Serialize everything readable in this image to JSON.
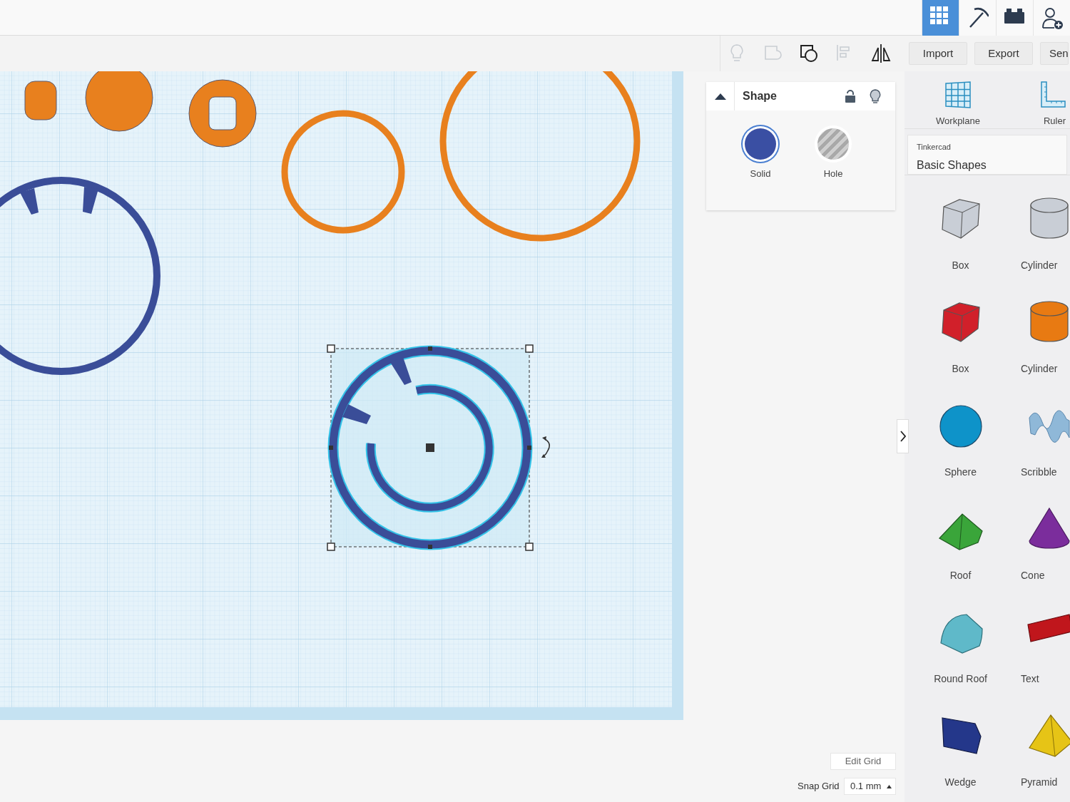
{
  "top_tabs": [
    {
      "kind": "grid",
      "selected": true
    },
    {
      "kind": "pickaxe",
      "selected": false
    },
    {
      "kind": "brick",
      "selected": false
    },
    {
      "kind": "user-add",
      "selected": false
    }
  ],
  "toolbar": {
    "tools": [
      {
        "kind": "bulb",
        "disabled": true
      },
      {
        "kind": "group",
        "disabled": true
      },
      {
        "kind": "ungroup",
        "disabled": false
      },
      {
        "kind": "align",
        "disabled": true
      },
      {
        "kind": "mirror",
        "disabled": false
      }
    ],
    "buttons": [
      "Import",
      "Export",
      "Sen"
    ]
  },
  "shape_panel": {
    "title": "Shape",
    "options": [
      {
        "label": "Solid",
        "kind": "solid",
        "selected": true
      },
      {
        "label": "Hole",
        "kind": "hole",
        "selected": false
      }
    ]
  },
  "grid_controls": {
    "edit_button": "Edit Grid",
    "snap_label": "Snap Grid",
    "snap_value": "0.1 mm"
  },
  "sidebar": {
    "tools": [
      {
        "label": "Workplane",
        "kind": "workplane"
      },
      {
        "label": "Ruler",
        "kind": "ruler"
      }
    ],
    "library": {
      "source": "Tinkercad",
      "name": "Basic Shapes"
    },
    "shapes": [
      {
        "label": "Box",
        "kind": "box",
        "color": "#c9ced6"
      },
      {
        "label": "Cylinder",
        "kind": "cylinder",
        "color": "#c9ced6"
      },
      {
        "label": "Box",
        "kind": "box",
        "color": "#d1202a"
      },
      {
        "label": "Cylinder",
        "kind": "cylinder",
        "color": "#e87a12"
      },
      {
        "label": "Sphere",
        "kind": "sphere",
        "color": "#0e93c9"
      },
      {
        "label": "Scribble",
        "kind": "scribble",
        "color": "#8fb8d8"
      },
      {
        "label": "Roof",
        "kind": "roof",
        "color": "#3aa53a"
      },
      {
        "label": "Cone",
        "kind": "cone",
        "color": "#7b2d9c"
      },
      {
        "label": "Round Roof",
        "kind": "roundroof",
        "color": "#5fb9c9"
      },
      {
        "label": "Text",
        "kind": "text",
        "color": "#c0161c"
      },
      {
        "label": "Wedge",
        "kind": "wedge",
        "color": "#24378a"
      },
      {
        "label": "Pyramid",
        "kind": "pyramid",
        "color": "#e6c416"
      }
    ]
  }
}
